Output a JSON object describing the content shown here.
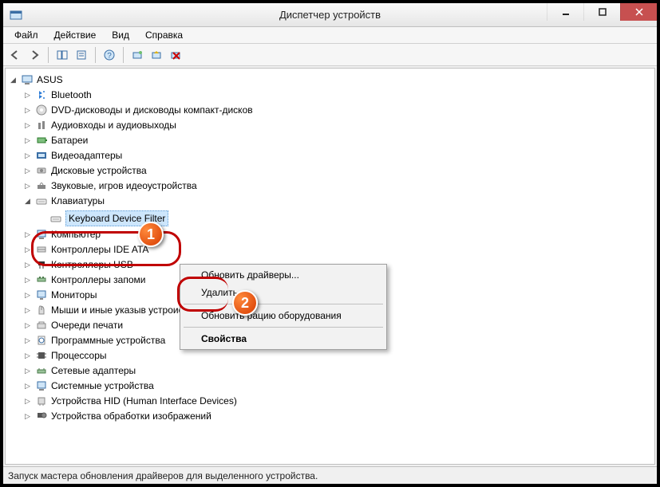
{
  "titlebar": {
    "title": "Диспетчер устройств"
  },
  "menubar": {
    "file": "Файл",
    "action": "Действие",
    "view": "Вид",
    "help": "Справка"
  },
  "tree": {
    "root": "ASUS",
    "items": [
      "Bluetooth",
      "DVD-дисководы и дисководы компакт-дисков",
      "Аудиовходы и аудиовыходы",
      "Батареи",
      "Видеоадаптеры",
      "Дисковые устройства",
      "Звуковые, игров            идеоустройства",
      "Клавиатуры",
      "Компьютер",
      "Контроллеры IDE ATA",
      "Контроллеры USB",
      "Контроллеры запоми",
      "Мониторы",
      "Мыши и иные указыв                устроиства",
      "Очереди печати",
      "Программные устройства",
      "Процессоры",
      "Сетевые адаптеры",
      "Системные устройства",
      "Устройства HID (Human Interface Devices)",
      "Устройства обработки изображений"
    ],
    "keyboardChild": "Keyboard Device Filter"
  },
  "contextMenu": {
    "update": "Обновить драйверы...",
    "delete": "Удалить",
    "scan": "Обновить               рацию оборудования",
    "properties": "Свойства"
  },
  "status": "Запуск мастера обновления драйверов для выделенного устройства.",
  "callouts": {
    "n1": "1",
    "n2": "2"
  }
}
